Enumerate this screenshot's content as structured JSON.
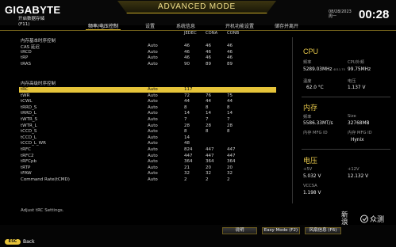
{
  "header": {
    "brand": "GIGABYTE",
    "mode_title": "ADVANCED MODE",
    "date": "08/28/2023",
    "weekday": "周一",
    "time": "00:28"
  },
  "page": {
    "title_line1": "开启数据存储",
    "title_line2": "(F11)"
  },
  "tabs": [
    {
      "label": "频率/电压控制",
      "active": true
    },
    {
      "label": "设置",
      "active": false
    },
    {
      "label": "系统信息",
      "active": false
    },
    {
      "label": "开机功能设置",
      "active": false
    },
    {
      "label": "储存并离开",
      "active": false
    }
  ],
  "columns": [
    "JEDEC",
    "CONA",
    "CONB"
  ],
  "section_basic": "内存基本时序控制",
  "section_adv": "内存高级时序控制",
  "basic_rows": [
    {
      "name": "CAS 延迟",
      "val": "Auto",
      "a": "46",
      "b": "46",
      "c": "46"
    },
    {
      "name": "tRCD",
      "val": "Auto",
      "a": "46",
      "b": "46",
      "c": "46"
    },
    {
      "name": "tRP",
      "val": "Auto",
      "a": "46",
      "b": "46",
      "c": "46"
    },
    {
      "name": "tRAS",
      "val": "Auto",
      "a": "90",
      "b": "89",
      "c": "89"
    }
  ],
  "adv_rows": [
    {
      "name": "tRC",
      "val": "Auto",
      "a": "117",
      "b": "",
      "c": "",
      "selected": true
    },
    {
      "name": "tWR",
      "val": "Auto",
      "a": "72",
      "b": "76",
      "c": "75"
    },
    {
      "name": "tCWL",
      "val": "Auto",
      "a": "44",
      "b": "44",
      "c": "44"
    },
    {
      "name": "tRRD_S",
      "val": "Auto",
      "a": "8",
      "b": "8",
      "c": "8"
    },
    {
      "name": "tRRD_L",
      "val": "Auto",
      "a": "14",
      "b": "14",
      "c": "14"
    },
    {
      "name": "tWTR_S",
      "val": "Auto",
      "a": "7",
      "b": "7",
      "c": "7"
    },
    {
      "name": "tWTR_L",
      "val": "Auto",
      "a": "28",
      "b": "28",
      "c": "28"
    },
    {
      "name": "tCCD_S",
      "val": "Auto",
      "a": "8",
      "b": "8",
      "c": "8"
    },
    {
      "name": "tCCD_L",
      "val": "Auto",
      "a": "14",
      "b": "",
      "c": ""
    },
    {
      "name": "tCCD_L_WR",
      "val": "Auto",
      "a": "48",
      "b": "",
      "c": ""
    },
    {
      "name": "tRFC",
      "val": "Auto",
      "a": "824",
      "b": "447",
      "c": "447"
    },
    {
      "name": "tRFC2",
      "val": "Auto",
      "a": "447",
      "b": "447",
      "c": "447"
    },
    {
      "name": "tRFCpb",
      "val": "Auto",
      "a": "364",
      "b": "364",
      "c": "364"
    },
    {
      "name": "tRTP",
      "val": "Auto",
      "a": "21",
      "b": "20",
      "c": "20"
    },
    {
      "name": "tFAW",
      "val": "Auto",
      "a": "32",
      "b": "32",
      "c": "32"
    },
    {
      "name": "Command Rate(tCMD)",
      "val": "Auto",
      "a": "2",
      "b": "2",
      "c": "2"
    }
  ],
  "hint": "Adjust tRC Settings.",
  "panel": {
    "cpu": {
      "title": "CPU",
      "freq_label": "频率",
      "freq_value": "5289.03MHz",
      "freq_sub": "4011.75",
      "bclk_label": "CPU外频",
      "bclk_value": "99.75MHz",
      "temp_label": "温度",
      "temp_value": "62.0 °C",
      "volt_label": "电压",
      "volt_value": "1.137 V"
    },
    "memory": {
      "title": "内存",
      "freq_label": "频率",
      "freq_value": "5586.33MT/s",
      "size_label": "Size",
      "size_value": "32768MB",
      "mfg_a_label": "内存 MFG ID",
      "mfg_a_value": "",
      "mfg_b_label": "内存 MFG ID",
      "mfg_b_value": "Hynix"
    },
    "voltage": {
      "title": "电压",
      "v5_label": "+5V",
      "v5_value": "5.032 V",
      "v12_label": "+12V",
      "v12_value": "12.132 V",
      "vccsa_label": "VCCSA",
      "vccsa_value": "1.198 V"
    }
  },
  "bottom": {
    "help": "说明",
    "easy_mode": "Easy Mode (F2)",
    "fan_info": "风扇信息 (F6)",
    "esc": "ESC",
    "back": "Back"
  },
  "watermark": {
    "line1": "新",
    "line2": "浪",
    "brand": "众测"
  },
  "colors": {
    "accent": "#e6c43a",
    "gold_text": "#e8c94b",
    "background": "#000000"
  }
}
